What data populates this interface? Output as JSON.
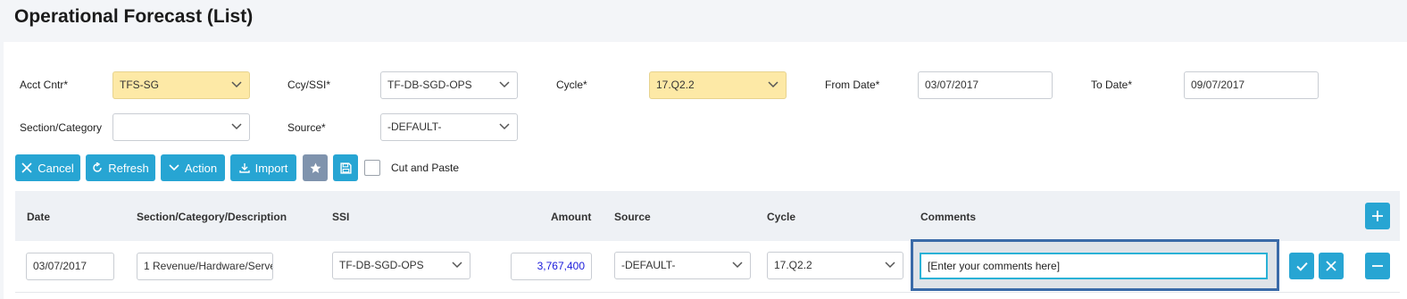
{
  "page": {
    "title": "Operational Forecast (List)"
  },
  "filters": {
    "acct_cntr": {
      "label": "Acct Cntr*",
      "value": "TFS-SG"
    },
    "ccy_ssi": {
      "label": "Ccy/SSI*",
      "value": "TF-DB-SGD-OPS"
    },
    "cycle": {
      "label": "Cycle*",
      "value": "17.Q2.2"
    },
    "from_date": {
      "label": "From Date*",
      "value": "03/07/2017"
    },
    "to_date": {
      "label": "To Date*",
      "value": "09/07/2017"
    },
    "section_category": {
      "label": "Section/Category",
      "value": ""
    },
    "source": {
      "label": "Source*",
      "value": "-DEFAULT-"
    }
  },
  "toolbar": {
    "cancel_label": "Cancel",
    "refresh_label": "Refresh",
    "action_label": "Action",
    "import_label": "Import",
    "cut_paste_label": "Cut and Paste"
  },
  "grid": {
    "columns": [
      "Date",
      "Section/Category/Description",
      "SSI",
      "Amount",
      "Source",
      "Cycle",
      "Comments"
    ],
    "row": {
      "date": "03/07/2017",
      "section": "1 Revenue/Hardware/Serve",
      "ssi": "TF-DB-SGD-OPS",
      "amount": "3,767,400",
      "source": "-DEFAULT-",
      "cycle": "17.Q2.2",
      "comments_placeholder": "[Enter your comments here]"
    }
  },
  "colors": {
    "accent": "#27a5d3",
    "highlight_field": "#fde9a6",
    "amount_text": "#1a1adb",
    "star_button": "#7f93ad"
  }
}
